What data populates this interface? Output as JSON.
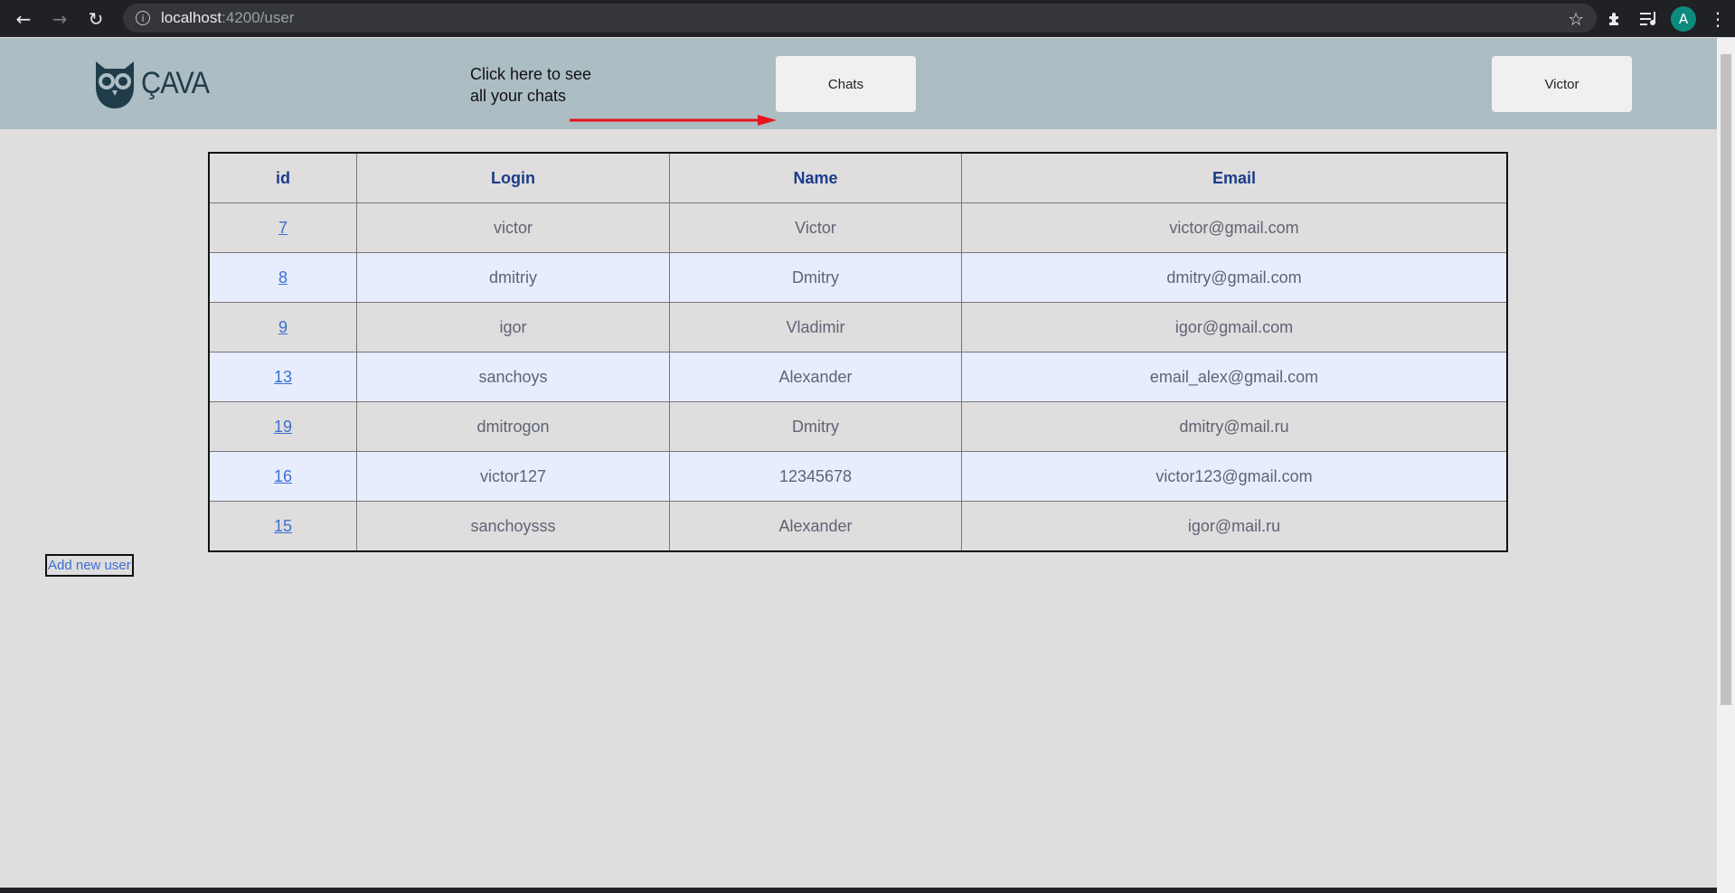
{
  "browser": {
    "url_host": "localhost",
    "url_path": ":4200/user",
    "avatar_letter": "A",
    "icons": [
      "back-icon",
      "forward-icon",
      "reload-icon",
      "info-icon",
      "star-icon",
      "extensions-icon",
      "reading-list-icon"
    ]
  },
  "header": {
    "logo_text": "ÇAVA",
    "hint_line1": "Click here to see",
    "hint_line2": "all your chats",
    "chats_button": "Chats",
    "user_button": "Victor",
    "arrow_color": "#e8141b"
  },
  "table": {
    "columns": [
      "id",
      "Login",
      "Name",
      "Email"
    ],
    "rows": [
      {
        "id": "7",
        "login": "victor",
        "name": "Victor",
        "email": "victor@gmail.com"
      },
      {
        "id": "8",
        "login": "dmitriy",
        "name": "Dmitry",
        "email": "dmitry@gmail.com"
      },
      {
        "id": "9",
        "login": "igor",
        "name": "Vladimir",
        "email": "igor@gmail.com"
      },
      {
        "id": "13",
        "login": "sanchoys",
        "name": "Alexander",
        "email": "email_alex@gmail.com"
      },
      {
        "id": "19",
        "login": "dmitrogon",
        "name": "Dmitry",
        "email": "dmitry@mail.ru"
      },
      {
        "id": "16",
        "login": "victor127",
        "name": "12345678",
        "email": "victor123@gmail.com"
      },
      {
        "id": "15",
        "login": "sanchoysss",
        "name": "Alexander",
        "email": "igor@mail.ru"
      }
    ]
  },
  "add_user_button": "Add new user"
}
